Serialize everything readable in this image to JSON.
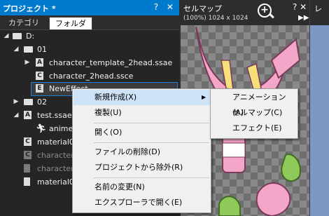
{
  "project": {
    "title": "プロジェクト *",
    "header_buttons": "? ✕",
    "tabs": [
      "カテゴリ",
      "フォルダ"
    ],
    "tree": [
      {
        "label": "D:",
        "icon": "folder-icon",
        "toggle": "◢"
      },
      {
        "label": "01",
        "icon": "folder-icon",
        "toggle": "◢"
      },
      {
        "label": "character_template_2head.ssae",
        "icon": "animation-file-icon",
        "badge": "A",
        "toggle": "▶"
      },
      {
        "label": "character_2head.ssce",
        "icon": "cellmap-file-icon",
        "badge": "C"
      },
      {
        "label": "NewEffect",
        "icon": "effect-file-icon",
        "badge": "E"
      },
      {
        "label": "02",
        "icon": "folder-icon",
        "toggle": "▶"
      },
      {
        "label": "test.ssae",
        "icon": "animation-file-icon",
        "badge": "A",
        "toggle": "◢"
      },
      {
        "label": "anime_",
        "icon": "runner-icon"
      },
      {
        "label": "material0",
        "icon": "cellmap-file-icon",
        "badge": "C"
      },
      {
        "label": "character_",
        "icon": "cellmap-file-icon",
        "badge": "C",
        "dim": true
      },
      {
        "label": "character_",
        "icon": "document-icon",
        "dim": true
      },
      {
        "label": "material0",
        "icon": "document-icon"
      }
    ]
  },
  "cellmap": {
    "title": "セルマップ",
    "subtitle": "(100%) 1024 x 1024",
    "buttons": "? ✕",
    "forward": "▶▶"
  },
  "right_panel": {
    "title": "レ"
  },
  "context_menu": {
    "items": [
      "新規作成(X)",
      "複製(U)",
      "開く(O)",
      "ファイルの削除(D)",
      "プロジェクトから除外(R)",
      "名前の変更(N)",
      "エクスプローラで開く(E)"
    ],
    "submenu_arrow": "▶"
  },
  "submenu": {
    "items": [
      "アニメーション(A)",
      "セルマップ(C)",
      "エフェクト(E)"
    ]
  },
  "colors": {
    "accent": "#007acc",
    "menu_bg": "#f0f0f0",
    "highlight": "#cfe3f8",
    "pink": "#f4a6c8",
    "green": "#8fc95a"
  }
}
